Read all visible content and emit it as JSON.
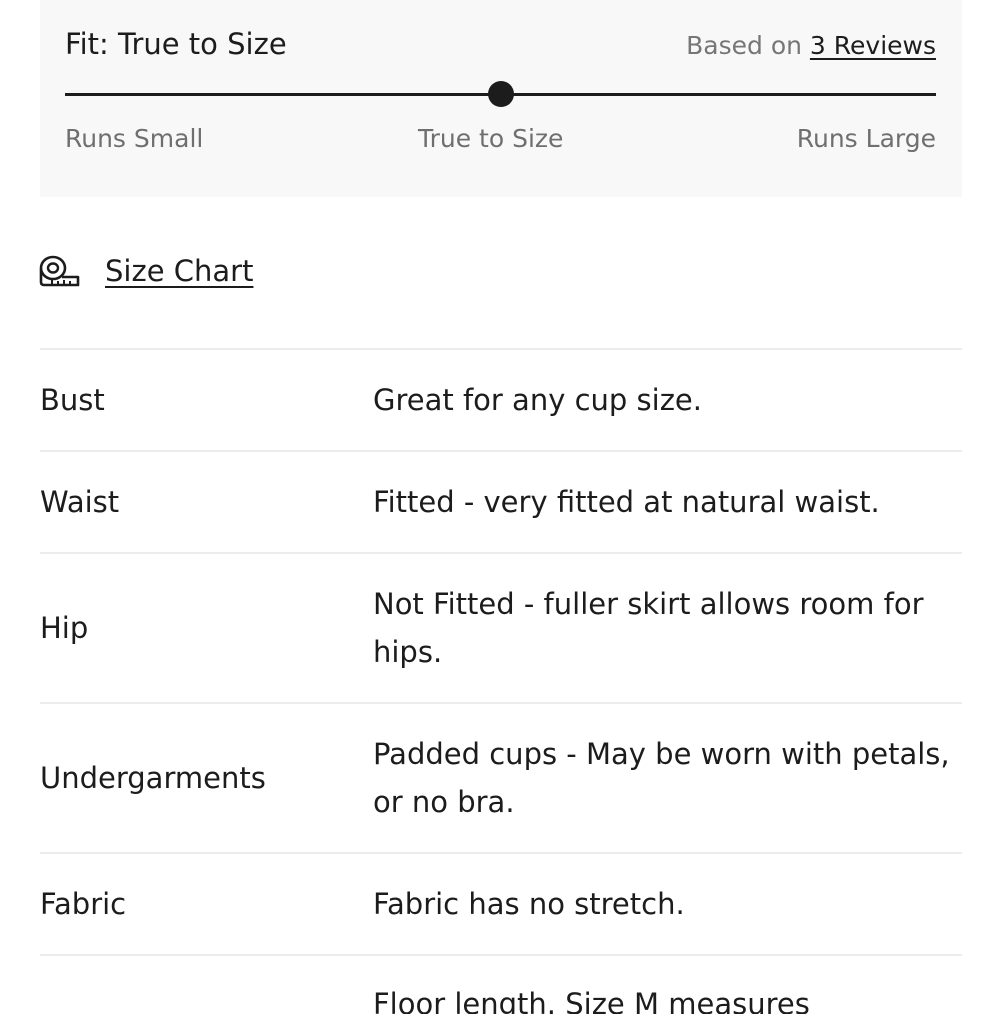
{
  "fit": {
    "title": "Fit: True to Size",
    "based_on_prefix": "Based on",
    "reviews_link": "3 Reviews",
    "scale_labels": [
      "Runs Small",
      "True to Size",
      "Runs Large"
    ],
    "marker_fraction": 0.5
  },
  "size_chart": {
    "icon": "measuring-tape-icon",
    "label": "Size Chart"
  },
  "details": [
    {
      "name": "Bust",
      "value": "Great for any cup size."
    },
    {
      "name": "Waist",
      "value": "Fitted - very fitted at natural waist."
    },
    {
      "name": "Hip",
      "value": "Not Fitted - fuller skirt allows room for hips."
    },
    {
      "name": "Undergarments",
      "value": "Padded cups - May be worn with petals, or no bra."
    },
    {
      "name": "Fabric",
      "value": "Fabric has no stretch."
    },
    {
      "name": "",
      "value": "Floor length. Size M measures"
    }
  ],
  "colors": {
    "text": "#1c1c1c",
    "muted": "#767676",
    "card_bg": "#f8f8f8",
    "divider": "#ececec"
  }
}
